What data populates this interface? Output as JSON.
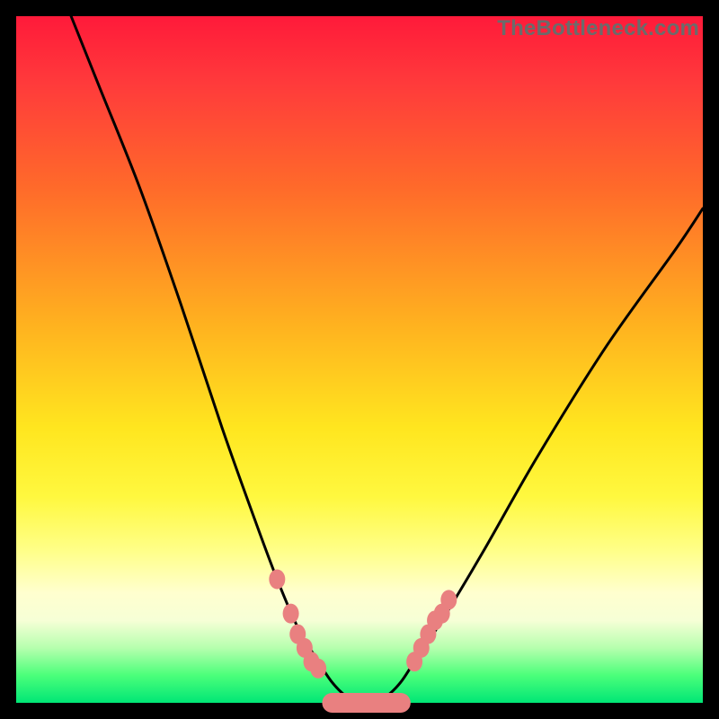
{
  "watermark": "TheBottleneck.com",
  "colors": {
    "background": "#000000",
    "curve": "#000000",
    "marker": "#e98080",
    "gradient_stops": [
      "#ff1a3a",
      "#ff3b3b",
      "#ff6a2a",
      "#ffb21f",
      "#ffe61f",
      "#fff83f",
      "#ffff8a",
      "#ffffcf",
      "#f6ffd6",
      "#b6ffae",
      "#4bff7a",
      "#00e676"
    ]
  },
  "chart_data": {
    "type": "line",
    "title": "",
    "xlabel": "",
    "ylabel": "",
    "xlim": [
      0,
      100
    ],
    "ylim": [
      0,
      100
    ],
    "grid": false,
    "legend": false,
    "series": [
      {
        "name": "bottleneck-curve",
        "x": [
          8,
          12,
          18,
          24,
          30,
          35,
          38,
          41,
          44,
          46,
          48,
          50,
          52,
          54,
          56,
          58,
          62,
          68,
          76,
          86,
          96,
          100
        ],
        "y": [
          100,
          90,
          75,
          58,
          40,
          26,
          18,
          11,
          6,
          3,
          1,
          0,
          0,
          1,
          3,
          6,
          12,
          22,
          36,
          52,
          66,
          72
        ]
      }
    ],
    "markers_left": [
      {
        "x": 38,
        "y": 18
      },
      {
        "x": 40,
        "y": 13
      },
      {
        "x": 41,
        "y": 10
      },
      {
        "x": 42,
        "y": 8
      },
      {
        "x": 43,
        "y": 6
      },
      {
        "x": 44,
        "y": 5
      }
    ],
    "markers_right": [
      {
        "x": 58,
        "y": 6
      },
      {
        "x": 59,
        "y": 8
      },
      {
        "x": 60,
        "y": 10
      },
      {
        "x": 61,
        "y": 12
      },
      {
        "x": 62,
        "y": 13
      },
      {
        "x": 63,
        "y": 15
      }
    ],
    "basin_pill": {
      "x0": 46,
      "x1": 56,
      "y": 0
    }
  }
}
